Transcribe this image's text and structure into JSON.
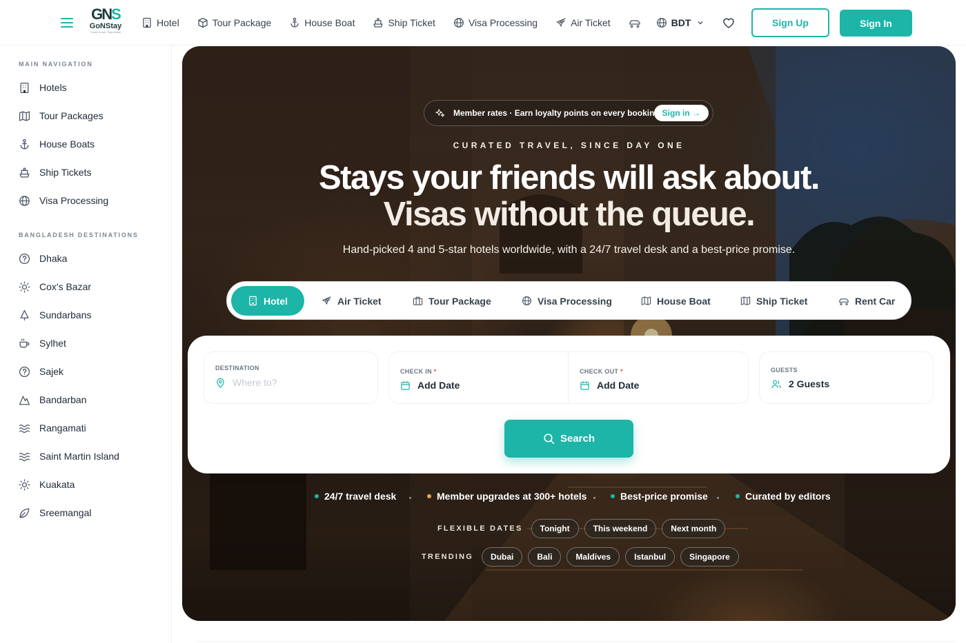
{
  "brand": {
    "mark_a": "GN",
    "mark_b": "S",
    "name": "GoNStay",
    "tagline": "Travel Smart, Stay Better"
  },
  "topnav": {
    "links": [
      "Hotel",
      "Tour Package",
      "House Boat",
      "Ship Ticket",
      "Visa Processing",
      "Air Ticket"
    ],
    "currency": "BDT",
    "signup": "Sign Up",
    "signin": "Sign In"
  },
  "sidebar": {
    "main_title": "MAIN NAVIGATION",
    "main_items": [
      "Hotels",
      "Tour Packages",
      "House Boats",
      "Ship Tickets",
      "Visa Processing"
    ],
    "dest_title": "BANGLADESH DESTINATIONS",
    "dest_items": [
      "Dhaka",
      "Cox's Bazar",
      "Sundarbans",
      "Sylhet",
      "Sajek",
      "Bandarban",
      "Rangamati",
      "Saint Martin Island",
      "Kuakata",
      "Sreemangal"
    ]
  },
  "hero": {
    "member_text": "Member rates · Earn loyalty points on every booking",
    "member_cta": "Sign in →",
    "kicker": "CURATED TRAVEL, SINCE DAY ONE",
    "headline_1": "Stays your friends will ask about.",
    "headline_2": "Visas without the queue.",
    "subline": "Hand-picked 4 and 5-star hotels worldwide, with a 24/7 travel desk and a best-price promise.",
    "tabs": [
      "Hotel",
      "Air Ticket",
      "Tour Package",
      "Visa Processing",
      "House Boat",
      "Ship Ticket",
      "Rent Car"
    ],
    "active_tab": "Hotel"
  },
  "search": {
    "destination_label": "DESTINATION",
    "destination_placeholder": "Where to?",
    "checkin_label": "CHECK IN",
    "checkin_value": "Add Date",
    "checkout_label": "CHECK OUT",
    "checkout_value": "Add Date",
    "required_mark": "*",
    "guests_label": "GUESTS",
    "guests_value": "2 Guests",
    "button": "Search"
  },
  "features": [
    "24/7 travel desk",
    "Member upgrades at 300+ hotels",
    "Best-price promise",
    "Curated by editors"
  ],
  "flexible": {
    "label": "FLEXIBLE DATES",
    "chips": [
      "Tonight",
      "This weekend",
      "Next month"
    ]
  },
  "trending": {
    "label": "TRENDING",
    "chips": [
      "Dubai",
      "Bali",
      "Maldives",
      "Istanbul",
      "Singapore"
    ]
  },
  "colors": {
    "accent": "#1cb5a8",
    "feature_dot_1": "#1cb5a8",
    "feature_dot_2": "#e0a84a",
    "feature_dot_3": "#1cb5a8",
    "feature_dot_4": "#1cb5a8"
  }
}
